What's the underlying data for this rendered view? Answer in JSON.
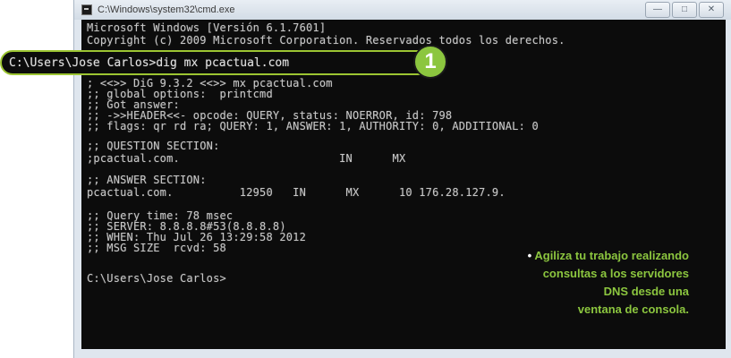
{
  "window": {
    "title": "C:\\Windows\\system32\\cmd.exe",
    "controls": {
      "minimize": "—",
      "maximize": "□",
      "close": "✕"
    }
  },
  "console": {
    "lines": [
      "Microsoft Windows [Versión 6.1.7601]",
      "Copyright (c) 2009 Microsoft Corporation. Reservados todos los derechos.",
      "; <<>> DiG 9.3.2 <<>> mx pcactual.com",
      ";; global options:  printcmd",
      ";; Got answer:",
      ";; ->>HEADER<<- opcode: QUERY, status: NOERROR, id: 798",
      ";; flags: qr rd ra; QUERY: 1, ANSWER: 1, AUTHORITY: 0, ADDITIONAL: 0",
      ";; QUESTION SECTION:",
      ";pcactual.com.                        IN      MX",
      ";; ANSWER SECTION:",
      "pcactual.com.          12950   IN      MX      10 176.28.127.9.",
      ";; Query time: 78 msec",
      ";; SERVER: 8.8.8.8#53(8.8.8.8)",
      ";; WHEN: Thu Jul 26 13:29:58 2012",
      ";; MSG SIZE  rcvd: 58",
      "C:\\Users\\Jose Carlos>"
    ]
  },
  "callout": {
    "command": "C:\\Users\\Jose Carlos>dig mx pcactual.com",
    "step_number": "1",
    "accent_color": "#8cc63f"
  },
  "caption": {
    "bullet": "•",
    "lines": [
      "Agiliza tu trabajo realizando",
      "consultas a los servidores",
      "DNS desde una",
      "ventana de consola."
    ]
  }
}
